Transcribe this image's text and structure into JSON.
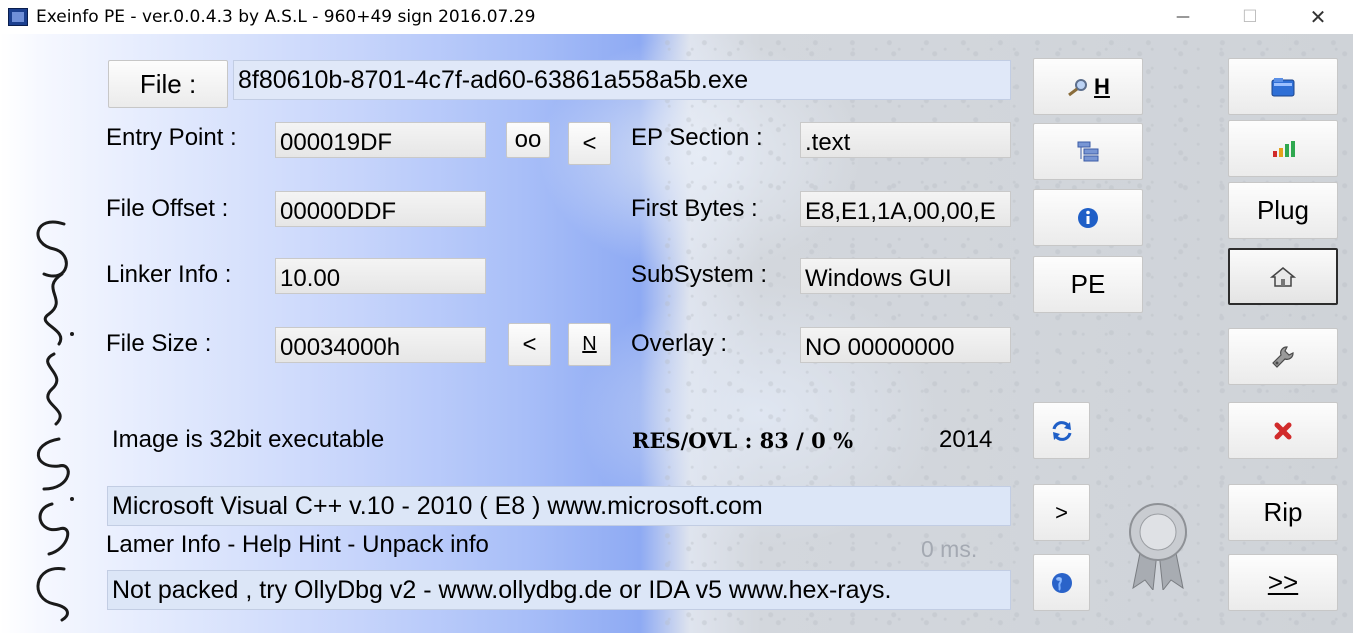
{
  "window": {
    "title": "Exeinfo PE - ver.0.0.4.3  by A.S.L -  960+49 sign  2016.07.29",
    "minimize_glyph": "—",
    "maximize_glyph": "☐",
    "close_glyph": "✕"
  },
  "file": {
    "button_label": "File :",
    "value": "8f80610b-8701-4c7f-ad60-63861a558a5b.exe"
  },
  "fields": {
    "entry_point_label": "Entry Point :",
    "entry_point_value": "000019DF",
    "oo_label": "oo",
    "lt1_label": "<",
    "ep_section_label": "EP Section :",
    "ep_section_value": ".text",
    "file_offset_label": "File Offset :",
    "file_offset_value": "00000DDF",
    "first_bytes_label": "First Bytes :",
    "first_bytes_value": "E8,E1,1A,00,00,E",
    "linker_info_label": "Linker Info :",
    "linker_info_value": "10.00",
    "subsystem_label": "SubSystem :",
    "subsystem_value": "Windows GUI",
    "file_size_label": "File Size :",
    "file_size_value": "00034000h",
    "lt2_label": "<",
    "n_label": "N",
    "overlay_label": "Overlay :",
    "overlay_value": "NO   00000000"
  },
  "status": {
    "image_text": "Image is 32bit executable",
    "res_ovl": "RES/OVL : 83 / 0 %",
    "year": "2014",
    "detection": "Microsoft Visual C++ v.10 - 2010 ( E8 ) www.microsoft.com",
    "hint_label": "Lamer Info - Help Hint - Unpack info",
    "time": "0 ms.",
    "advice": "Not packed , try OllyDbg v2 - www.ollydbg.de or IDA v5 www.hex-rays."
  },
  "middle_buttons": {
    "h_label": "H",
    "pe_label": "PE",
    "next_label": ">"
  },
  "right_buttons": {
    "plug_label": "Plug",
    "rip_label": "Rip",
    "more_label": ">>"
  },
  "colors": {
    "accent_blue": "#2a63c9",
    "detection_bg": "#dce6f7",
    "close_red": "#d12b2b"
  }
}
